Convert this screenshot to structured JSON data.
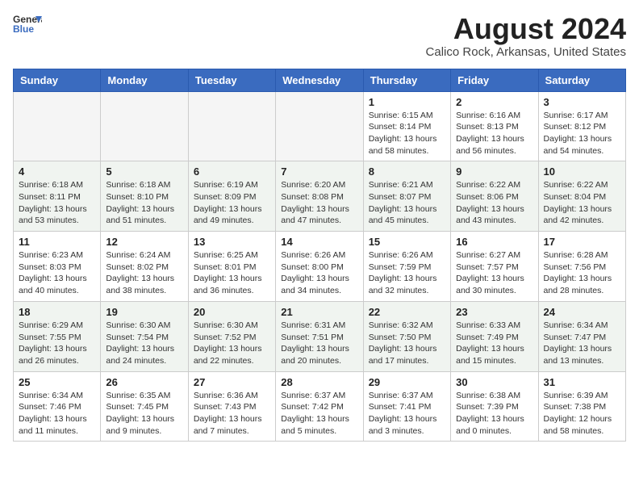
{
  "header": {
    "logo_line1": "General",
    "logo_line2": "Blue",
    "month_year": "August 2024",
    "location": "Calico Rock, Arkansas, United States"
  },
  "weekdays": [
    "Sunday",
    "Monday",
    "Tuesday",
    "Wednesday",
    "Thursday",
    "Friday",
    "Saturday"
  ],
  "weeks": [
    [
      {
        "day": "",
        "empty": true
      },
      {
        "day": "",
        "empty": true
      },
      {
        "day": "",
        "empty": true
      },
      {
        "day": "",
        "empty": true
      },
      {
        "day": "1",
        "sunrise": "6:15 AM",
        "sunset": "8:14 PM",
        "daylight": "13 hours and 58 minutes."
      },
      {
        "day": "2",
        "sunrise": "6:16 AM",
        "sunset": "8:13 PM",
        "daylight": "13 hours and 56 minutes."
      },
      {
        "day": "3",
        "sunrise": "6:17 AM",
        "sunset": "8:12 PM",
        "daylight": "13 hours and 54 minutes."
      }
    ],
    [
      {
        "day": "4",
        "sunrise": "6:18 AM",
        "sunset": "8:11 PM",
        "daylight": "13 hours and 53 minutes."
      },
      {
        "day": "5",
        "sunrise": "6:18 AM",
        "sunset": "8:10 PM",
        "daylight": "13 hours and 51 minutes."
      },
      {
        "day": "6",
        "sunrise": "6:19 AM",
        "sunset": "8:09 PM",
        "daylight": "13 hours and 49 minutes."
      },
      {
        "day": "7",
        "sunrise": "6:20 AM",
        "sunset": "8:08 PM",
        "daylight": "13 hours and 47 minutes."
      },
      {
        "day": "8",
        "sunrise": "6:21 AM",
        "sunset": "8:07 PM",
        "daylight": "13 hours and 45 minutes."
      },
      {
        "day": "9",
        "sunrise": "6:22 AM",
        "sunset": "8:06 PM",
        "daylight": "13 hours and 43 minutes."
      },
      {
        "day": "10",
        "sunrise": "6:22 AM",
        "sunset": "8:04 PM",
        "daylight": "13 hours and 42 minutes."
      }
    ],
    [
      {
        "day": "11",
        "sunrise": "6:23 AM",
        "sunset": "8:03 PM",
        "daylight": "13 hours and 40 minutes."
      },
      {
        "day": "12",
        "sunrise": "6:24 AM",
        "sunset": "8:02 PM",
        "daylight": "13 hours and 38 minutes."
      },
      {
        "day": "13",
        "sunrise": "6:25 AM",
        "sunset": "8:01 PM",
        "daylight": "13 hours and 36 minutes."
      },
      {
        "day": "14",
        "sunrise": "6:26 AM",
        "sunset": "8:00 PM",
        "daylight": "13 hours and 34 minutes."
      },
      {
        "day": "15",
        "sunrise": "6:26 AM",
        "sunset": "7:59 PM",
        "daylight": "13 hours and 32 minutes."
      },
      {
        "day": "16",
        "sunrise": "6:27 AM",
        "sunset": "7:57 PM",
        "daylight": "13 hours and 30 minutes."
      },
      {
        "day": "17",
        "sunrise": "6:28 AM",
        "sunset": "7:56 PM",
        "daylight": "13 hours and 28 minutes."
      }
    ],
    [
      {
        "day": "18",
        "sunrise": "6:29 AM",
        "sunset": "7:55 PM",
        "daylight": "13 hours and 26 minutes."
      },
      {
        "day": "19",
        "sunrise": "6:30 AM",
        "sunset": "7:54 PM",
        "daylight": "13 hours and 24 minutes."
      },
      {
        "day": "20",
        "sunrise": "6:30 AM",
        "sunset": "7:52 PM",
        "daylight": "13 hours and 22 minutes."
      },
      {
        "day": "21",
        "sunrise": "6:31 AM",
        "sunset": "7:51 PM",
        "daylight": "13 hours and 20 minutes."
      },
      {
        "day": "22",
        "sunrise": "6:32 AM",
        "sunset": "7:50 PM",
        "daylight": "13 hours and 17 minutes."
      },
      {
        "day": "23",
        "sunrise": "6:33 AM",
        "sunset": "7:49 PM",
        "daylight": "13 hours and 15 minutes."
      },
      {
        "day": "24",
        "sunrise": "6:34 AM",
        "sunset": "7:47 PM",
        "daylight": "13 hours and 13 minutes."
      }
    ],
    [
      {
        "day": "25",
        "sunrise": "6:34 AM",
        "sunset": "7:46 PM",
        "daylight": "13 hours and 11 minutes."
      },
      {
        "day": "26",
        "sunrise": "6:35 AM",
        "sunset": "7:45 PM",
        "daylight": "13 hours and 9 minutes."
      },
      {
        "day": "27",
        "sunrise": "6:36 AM",
        "sunset": "7:43 PM",
        "daylight": "13 hours and 7 minutes."
      },
      {
        "day": "28",
        "sunrise": "6:37 AM",
        "sunset": "7:42 PM",
        "daylight": "13 hours and 5 minutes."
      },
      {
        "day": "29",
        "sunrise": "6:37 AM",
        "sunset": "7:41 PM",
        "daylight": "13 hours and 3 minutes."
      },
      {
        "day": "30",
        "sunrise": "6:38 AM",
        "sunset": "7:39 PM",
        "daylight": "13 hours and 0 minutes."
      },
      {
        "day": "31",
        "sunrise": "6:39 AM",
        "sunset": "7:38 PM",
        "daylight": "12 hours and 58 minutes."
      }
    ]
  ]
}
